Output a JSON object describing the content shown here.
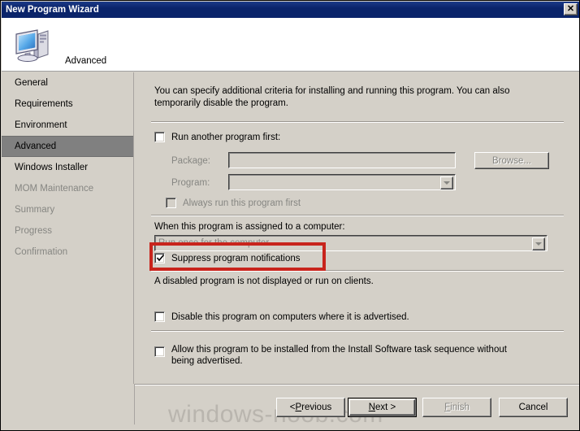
{
  "window": {
    "title": "New Program Wizard",
    "close_label": "✕"
  },
  "header": {
    "title": "Advanced",
    "icon": "computer-icon"
  },
  "sidebar": {
    "items": [
      {
        "label": "General",
        "state": "normal"
      },
      {
        "label": "Requirements",
        "state": "normal"
      },
      {
        "label": "Environment",
        "state": "normal"
      },
      {
        "label": "Advanced",
        "state": "selected"
      },
      {
        "label": "Windows Installer",
        "state": "normal"
      },
      {
        "label": "MOM Maintenance",
        "state": "disabled"
      },
      {
        "label": "Summary",
        "state": "disabled"
      },
      {
        "label": "Progress",
        "state": "disabled"
      },
      {
        "label": "Confirmation",
        "state": "disabled"
      }
    ]
  },
  "main": {
    "intro": "You can specify additional criteria for installing and running this program. You can also temporarily disable the program.",
    "run_another": {
      "label": "Run another program first:",
      "checked": false
    },
    "package": {
      "label": "Package:",
      "value": "",
      "placeholder": ""
    },
    "program": {
      "label": "Program:",
      "value": ""
    },
    "browse_label": "Browse...",
    "always_run": {
      "label": "Always run this program first",
      "checked": false
    },
    "assigned_label": "When this program is assigned to a computer:",
    "assigned_value": "Run once for the computer",
    "suppress": {
      "label": "Suppress program notifications",
      "checked": true
    },
    "disabled_note": "A disabled program is not displayed or run on clients.",
    "disable_program": {
      "label": "Disable this program on computers where it is advertised.",
      "checked": false
    },
    "allow_task_sequence": {
      "label": "Allow this program to be installed from the Install Software task sequence without being advertised.",
      "checked": false
    }
  },
  "footer": {
    "previous": {
      "pre": "< ",
      "accel": "P",
      "post": "revious"
    },
    "next": {
      "pre": "",
      "accel": "N",
      "post": "ext >"
    },
    "finish": {
      "pre": "",
      "accel": "F",
      "post": "inish"
    },
    "cancel": {
      "pre": "",
      "accel": "",
      "post": "Cancel"
    }
  },
  "annotation": {
    "color": "#c8241c"
  },
  "watermark": {
    "text": "windows-noob.com"
  }
}
